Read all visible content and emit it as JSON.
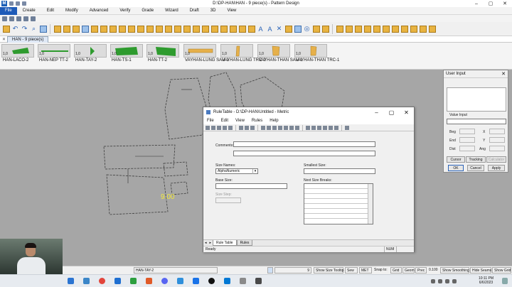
{
  "window": {
    "title": "D:\\DP-HAN\\HAN  -  9 piece(s)  -  Pattern Design",
    "app_icon": "letter-m-icon"
  },
  "menu": [
    "File",
    "Create",
    "Edit",
    "Modify",
    "Advanced",
    "Verify",
    "Grade",
    "Wizard",
    "Draft",
    "3D",
    "View"
  ],
  "piece_tab": {
    "label": "HAN - 9 piece(s)"
  },
  "pieces": [
    {
      "qty": "1,0",
      "name": "HAN-LACO-2",
      "color": "#2e9b2e"
    },
    {
      "qty": "1,0",
      "name": "HAN-NEP TT-2",
      "color": "#2e9b2e"
    },
    {
      "qty": "1,0",
      "name": "HAN-TAY-2",
      "color": "#2e9b2e"
    },
    {
      "qty": "1,0",
      "name": "HAN-TS-1",
      "color": "#2e9b2e"
    },
    {
      "qty": "1,0",
      "name": "HAN-TT-2",
      "color": "#2e9b2e"
    },
    {
      "qty": "1,0",
      "name": "VAYHAN-LUNG SAU-1",
      "color": "#e6b04a"
    },
    {
      "qty": "1,0",
      "name": "VAYHAN-LUNG TRC-2",
      "color": "#e6b04a"
    },
    {
      "qty": "1,0",
      "name": "VAYHAN-THAN SAU-1",
      "color": "#e6b04a"
    },
    {
      "qty": "1,0",
      "name": "VAYHAN-THAN TRC-1",
      "color": "#e6b04a"
    }
  ],
  "workarea": {
    "size_label": "9.00"
  },
  "ruletable": {
    "title": "RuleTable - D:\\DP-HAN\\Untitled - Metric",
    "menu": [
      "File",
      "Edit",
      "View",
      "Rules",
      "Help"
    ],
    "comments_label": "Comments:",
    "size_names_label": "Size Names:",
    "size_names_value": "AlphaNumeric",
    "smallest_size_label": "Smallest Size:",
    "base_size_label": "Base Size:",
    "next_size_breaks_label": "Next Size Breaks:",
    "size_step_label": "Size Step:",
    "tabs": [
      "Rule Table",
      "Rules"
    ],
    "status": "Ready",
    "num": "NUM"
  },
  "user_input": {
    "title": "User Input",
    "value_input_label": "Value Input",
    "beg": "Beg",
    "end": "End",
    "dist": "Dist",
    "x": "X",
    "y": "Y",
    "ang": "Ang",
    "cursor": "Cursor",
    "tracking": "Tracking",
    "calculator": "Calculator",
    "ok": "OK",
    "cancel": "Cancel",
    "apply": "Apply"
  },
  "statusbar": {
    "piece": "HAN-TAY-2",
    "size_value": "9",
    "show_size_tooltip": "Show Size Tooltip",
    "sew": "Sew",
    "met": "MET",
    "snap_to": "Snap to:",
    "grid": "Grid",
    "geom": "Geom",
    "prec": "Prec",
    "prec_value": "0.100",
    "show_smoothing": "Show Smoothing",
    "hide_seams": "Hide Seams",
    "show_grid": "Show Grid"
  },
  "taskbar": {
    "time": "10:11 PM",
    "date": "6/6/2023"
  }
}
